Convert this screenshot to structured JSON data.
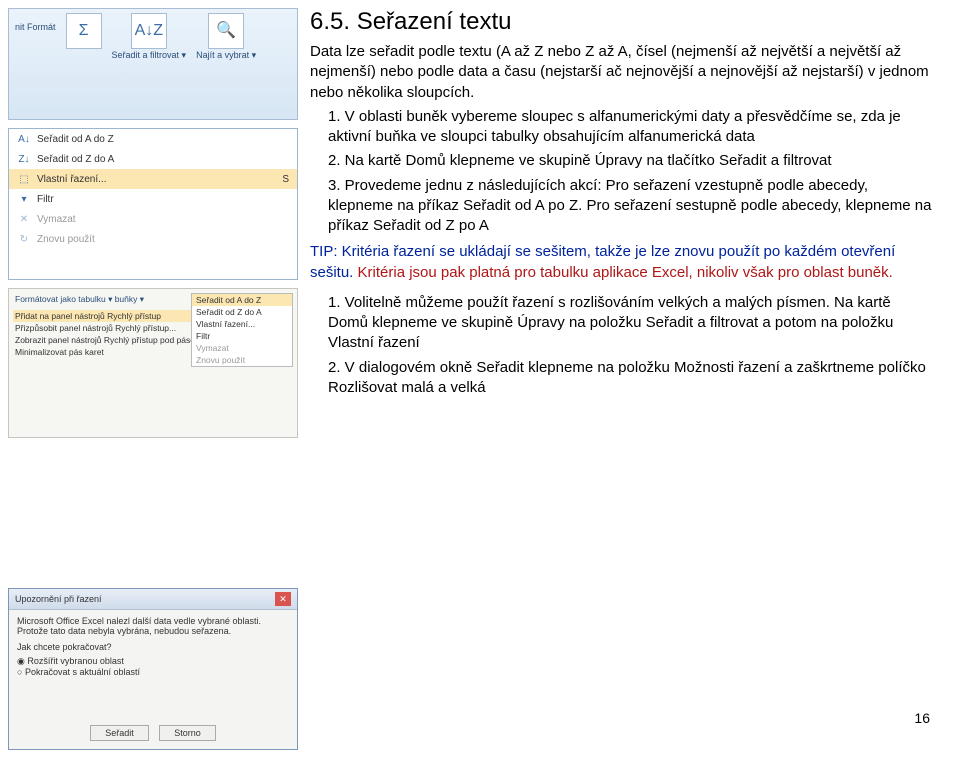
{
  "title": "6.5. Seřazení textu",
  "intro": "Data lze seřadit podle textu (A až Z nebo Z až A, čísel (nejmenší až největší a největší až nejmenší) nebo podle data a času (nejstarší ač nejnovější a nejnovější až nejstarší) v jednom nebo několika sloupcích.",
  "steps": {
    "s1": "1. V oblasti buněk vybereme sloupec s alfanumerickými daty a přesvědčíme se, zda je aktivní buňka ve sloupci tabulky  obsahujícím alfanumerická data",
    "s2": "2. Na kartě Domů klepneme ve skupině Úpravy na tlačítko Seřadit a filtrovat",
    "s3": "3. Provedeme jednu z následujících akcí: Pro seřazení vzestupně podle abecedy, klepneme na příkaz Seřadit od A po Z. Pro seřazení sestupně podle abecedy, klepneme na příkaz Seřadit od Z po A"
  },
  "tip": {
    "blue": "TIP: Kritéria řazení se ukládají se sešitem, takže je lze znovu použít po každém otevření sešitu.",
    "red": " Kritéria jsou pak platná pro tabulku aplikace Excel, nikoliv však pro oblast buněk."
  },
  "steps2": {
    "s1": "1. Volitelně můžeme použít řazení s rozlišováním velkých a malých písmen. Na kartě Domů klepneme ve skupině Úpravy  na položku Seřadit a filtrovat a potom na položku Vlastní řazení",
    "s2": "2. V dialogovém okně Seřadit klepneme na položku Možnosti řazení a zaškrtneme políčko Rozlišovat malá a velká"
  },
  "page_num": "16",
  "ribbon": {
    "b1": "Σ",
    "b2": "A↓Z",
    "b3": "🔍",
    "l0": "nit Formát",
    "l1": "Seřadit a filtrovat ▾",
    "l2": "Najít a vybrat ▾"
  },
  "menu": {
    "m1": "Seřadit od A do Z",
    "m2": "Seřadit od Z do A",
    "m3": "Vlastní řazení...",
    "m4": "Filtr",
    "m5": "Vymazat",
    "m6": "Znovu použít",
    "key": "S"
  },
  "qat": {
    "l1": "Přidat na panel nástrojů Rychlý přístup",
    "l2": "Přizpůsobit panel nástrojů Rychlý přístup...",
    "l3": "Zobrazit panel nástrojů Rychlý přístup pod pásem karet",
    "l4": "Minimalizovat pás karet",
    "s1": "Seřadit od A do Z",
    "s2": "Seřadit od Z do A",
    "s3": "Vlastní řazení...",
    "s4": "Filtr",
    "s5": "Vymazat",
    "s6": "Znovu použít",
    "hdr": "Formátovat jako tabulku ▾ buňky ▾"
  },
  "dlg": {
    "title": "Upozornění při řazení",
    "msg": "Microsoft Office Excel nalezl další data vedle vybrané oblasti. Protože tato data nebyla vybrána, nebudou seřazena.",
    "q": "Jak chcete pokračovat?",
    "o1": "Rozšířit vybranou oblast",
    "o2": "Pokračovat s aktuální oblastí",
    "btn1": "Seřadit",
    "btn2": "Storno"
  }
}
